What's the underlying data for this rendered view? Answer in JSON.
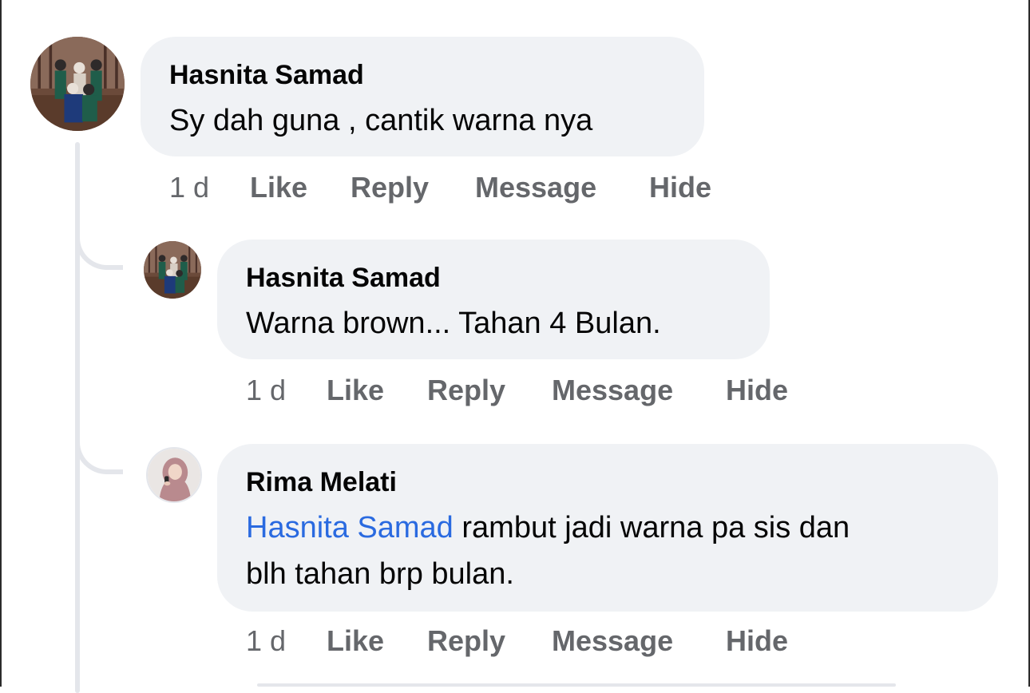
{
  "comments": [
    {
      "author": "Hasnita Samad",
      "text": "Sy dah guna , cantik warna nya",
      "time": "1 d",
      "actions": [
        "Like",
        "Reply",
        "Message",
        "Hide"
      ]
    },
    {
      "author": "Hasnita Samad",
      "text": "Warna brown... Tahan 4 Bulan.",
      "time": "1 d",
      "actions": [
        "Like",
        "Reply",
        "Message",
        "Hide"
      ]
    },
    {
      "author": "Rima Melati",
      "mention": "Hasnita Samad",
      "text_line1": " rambut jadi warna pa sis dan",
      "text_line2": "blh tahan brp bulan.",
      "time": "1 d",
      "actions": [
        "Like",
        "Reply",
        "Message",
        "Hide"
      ]
    }
  ],
  "colors": {
    "bubble": "#f0f2f5",
    "mention": "#2a6ae0",
    "secondary_text": "#65676b",
    "thread_line": "#e4e6eb"
  }
}
